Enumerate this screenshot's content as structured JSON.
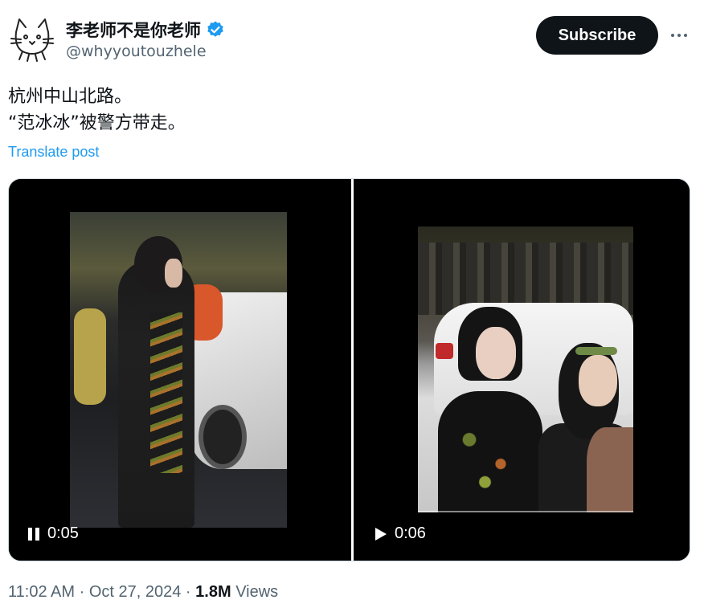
{
  "author": {
    "name": "李老师不是你老师",
    "handle": "@whyyoutouzhele",
    "verified": true
  },
  "actions": {
    "subscribe_label": "Subscribe",
    "more_icon": "more-horizontal-icon"
  },
  "post": {
    "line1": "杭州中山北路。",
    "line2": "“范冰冰”被警方带走。",
    "translate_label": "Translate post"
  },
  "videos": [
    {
      "state": "playing",
      "time": "0:05"
    },
    {
      "state": "paused",
      "time": "0:06"
    }
  ],
  "meta": {
    "time": "11:02 AM",
    "date": "Oct 27, 2024",
    "separator": "·",
    "views_count": "1.8M",
    "views_label": "Views"
  },
  "colors": {
    "link": "#1d9bf0",
    "verified": "#1d9bf0",
    "text": "#0f1419",
    "muted": "#536471"
  }
}
